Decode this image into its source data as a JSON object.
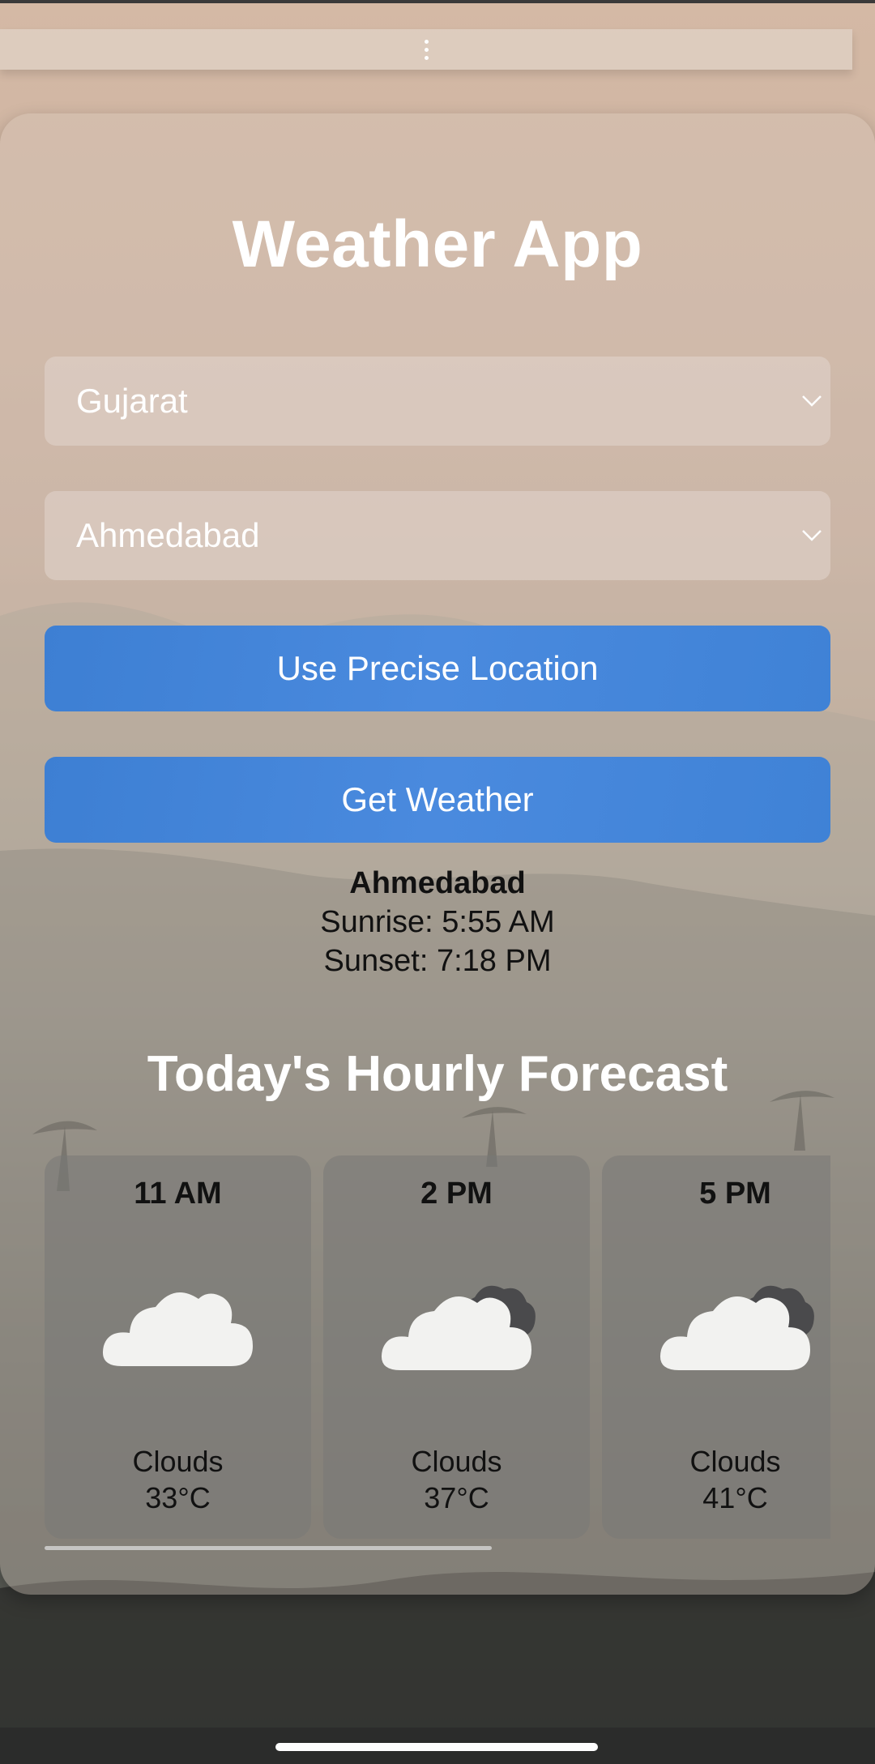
{
  "app": {
    "title": "Weather App"
  },
  "menu": {
    "icon": "more-vertical-icon"
  },
  "state_select": {
    "value": "Gujarat",
    "icon": "chevron-down-icon"
  },
  "city_select": {
    "value": "Ahmedabad",
    "icon": "chevron-down-icon"
  },
  "buttons": {
    "precise_location": "Use Precise Location",
    "get_weather": "Get Weather"
  },
  "current": {
    "city": "Ahmedabad",
    "sunrise": "Sunrise: 5:55 AM",
    "sunset": "Sunset: 7:18 PM"
  },
  "forecast": {
    "title": "Today's Hourly Forecast",
    "hours": [
      {
        "time": "11 AM",
        "condition": "Clouds",
        "temp": "33°C",
        "icon": "cloud-icon"
      },
      {
        "time": "2 PM",
        "condition": "Clouds",
        "temp": "37°C",
        "icon": "cloudy-icon"
      },
      {
        "time": "5 PM",
        "condition": "Clouds",
        "temp": "41°C",
        "icon": "cloudy-icon"
      }
    ]
  },
  "colors": {
    "button_blue": "#4a8ade",
    "title_white": "#ffffff",
    "text_dark": "#111111"
  }
}
